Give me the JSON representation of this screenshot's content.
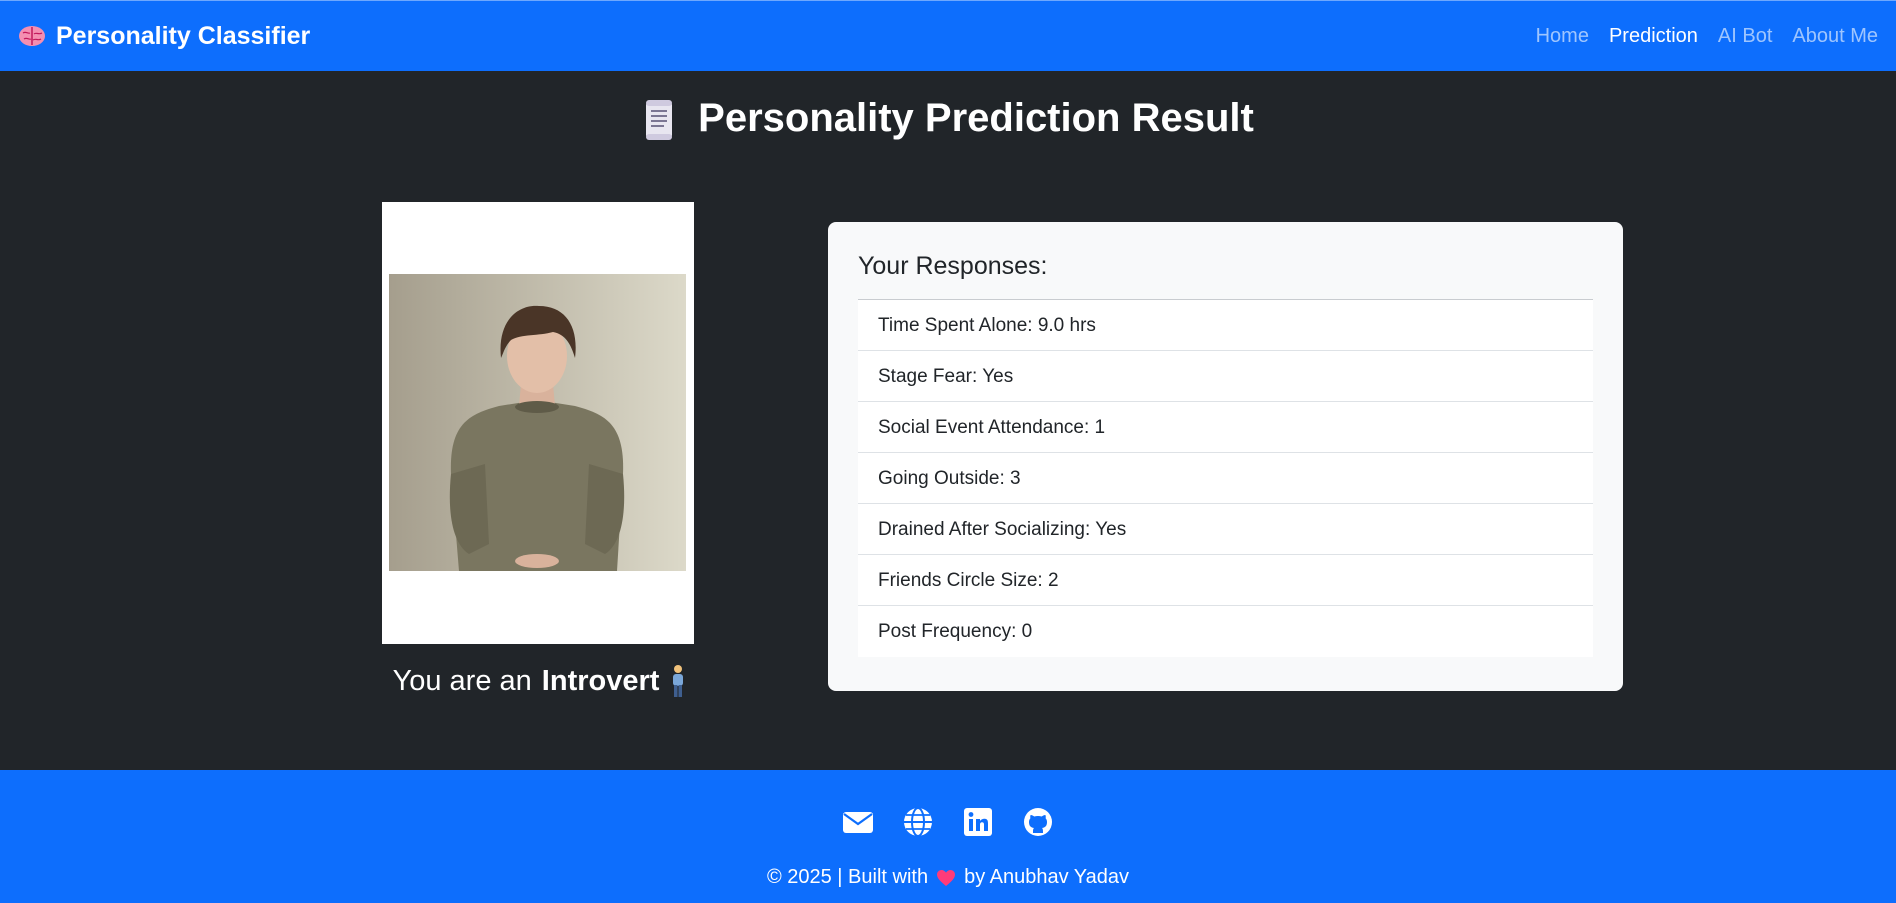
{
  "navbar": {
    "brand_label": "Personality Classifier",
    "brand_icon": "brain-icon",
    "links": [
      {
        "label": "Home",
        "active": false
      },
      {
        "label": "Prediction",
        "active": true
      },
      {
        "label": "AI Bot",
        "active": false
      },
      {
        "label": "About Me",
        "active": false
      }
    ]
  },
  "page": {
    "title": "Personality Prediction Result",
    "title_icon": "scroll-icon"
  },
  "result": {
    "prefix": "You are an",
    "type": "Introvert",
    "icon": "standing-person-icon",
    "photo": "introvert-person-photo"
  },
  "responses": {
    "heading": "Your Responses:",
    "items": [
      "Time Spent Alone: 9.0 hrs",
      "Stage Fear: Yes",
      "Social Event Attendance: 1",
      "Going Outside: 3",
      "Drained After Socializing: Yes",
      "Friends Circle Size: 2",
      "Post Frequency: 0"
    ]
  },
  "footer": {
    "icons": [
      "envelope-icon",
      "globe-icon",
      "linkedin-icon",
      "github-icon"
    ],
    "text_before": "© 2025 | Built with",
    "text_after": "by Anubhav Yadav"
  },
  "colors": {
    "primary": "#0d6efd",
    "background": "#212529",
    "card": "#f8f9fa"
  }
}
